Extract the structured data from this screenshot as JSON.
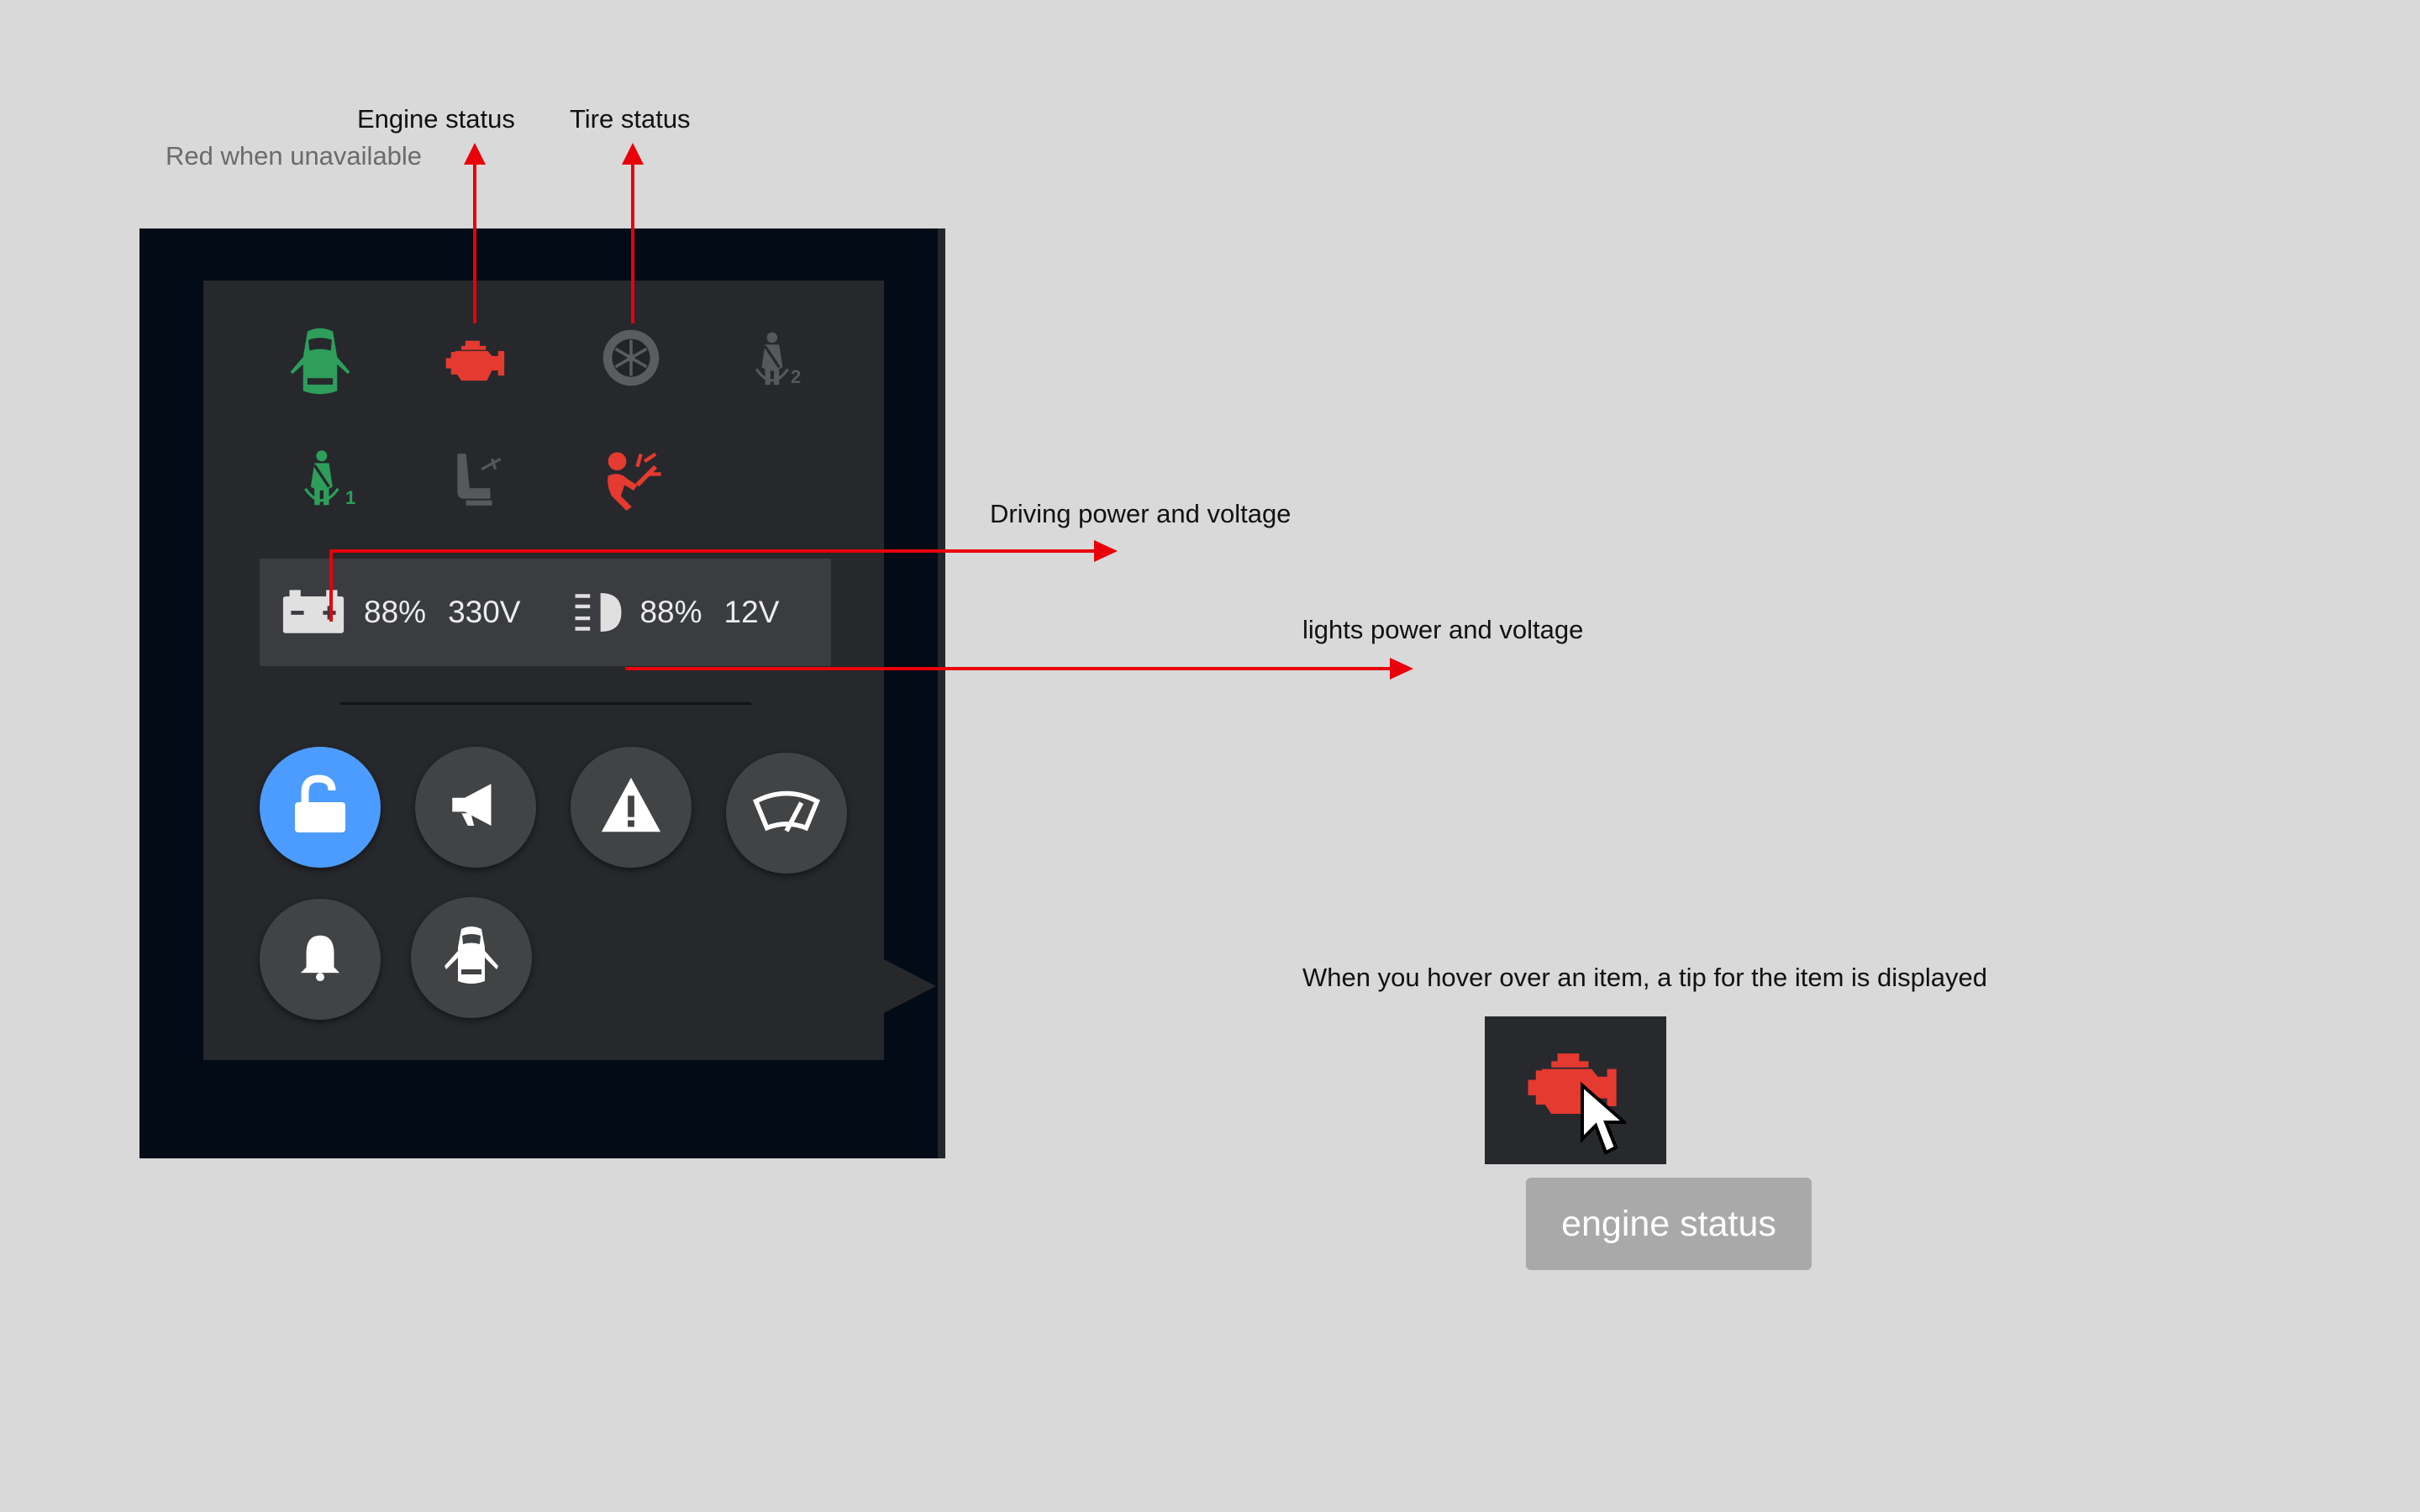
{
  "annotations": {
    "engine_status": "Engine status",
    "tire_status": "Tire status",
    "red_when_unavailable": "Red when unavailable",
    "driving_power": "Driving power and voltage",
    "lights_power": "lights power and voltage",
    "hover_tip_note": "When you hover over an item, a tip for the item is displayed"
  },
  "status_icons": [
    {
      "name": "door-open-icon",
      "color": "#2e9e5b"
    },
    {
      "name": "engine-icon",
      "color": "#e53a30"
    },
    {
      "name": "tire-icon",
      "color": "#5a5c5f"
    },
    {
      "name": "rear-seatbelt-icon",
      "color": "#56585b",
      "sub": "2"
    },
    {
      "name": "front-seatbelt-icon",
      "color": "#2e9e5b",
      "sub": "1"
    },
    {
      "name": "seat-icon",
      "color": "#56585b"
    },
    {
      "name": "airbag-icon",
      "color": "#e53a30"
    }
  ],
  "power": {
    "driving_percent": "88%",
    "driving_voltage": "330V",
    "lights_percent": "88%",
    "lights_voltage": "12V"
  },
  "controls": [
    {
      "name": "unlock-button",
      "icon": "unlock-icon",
      "active": true
    },
    {
      "name": "horn-button",
      "icon": "megaphone-icon"
    },
    {
      "name": "hazard-button",
      "icon": "warning-icon"
    },
    {
      "name": "wiper-button",
      "icon": "wiper-icon"
    },
    {
      "name": "alarm-button",
      "icon": "bell-icon"
    },
    {
      "name": "doors-button",
      "icon": "car-doors-icon"
    }
  ],
  "tooltip": {
    "text": "engine status"
  },
  "colors": {
    "background": "#d9d9d9",
    "frame": "#020b16",
    "panel": "#26282c",
    "ok_green": "#2e9e5b",
    "alert_red": "#e53a30",
    "accent_blue": "#4c9cff",
    "arrow_red": "#e8000b"
  }
}
